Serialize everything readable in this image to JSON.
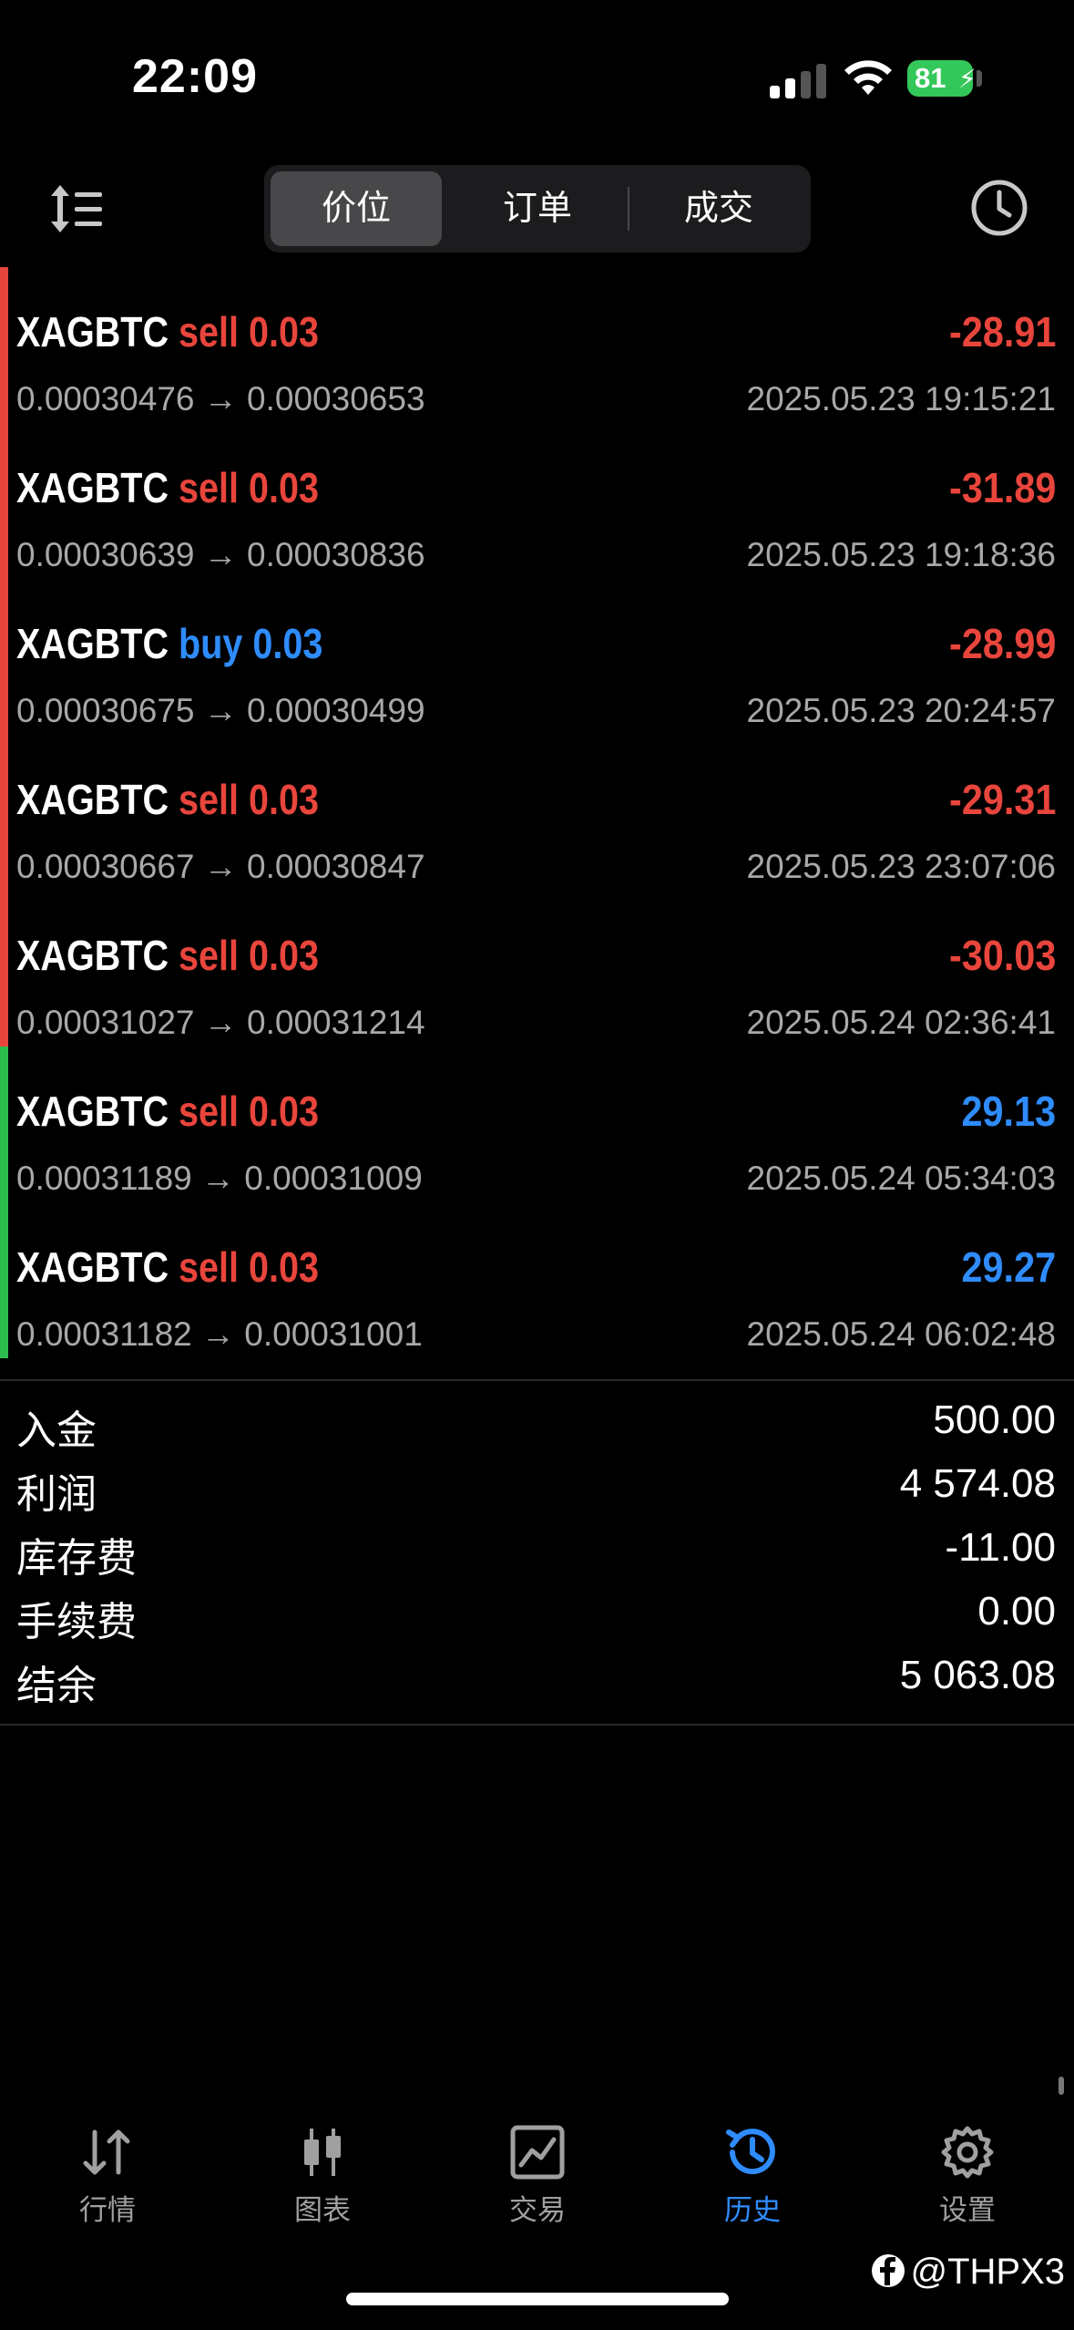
{
  "status_bar": {
    "time": "22:09",
    "battery": "81"
  },
  "toolbar": {
    "tabs": [
      {
        "label": "价位"
      },
      {
        "label": "订单"
      },
      {
        "label": "成交"
      }
    ]
  },
  "deals": [
    {
      "symbol": "XAGBTC",
      "type": "sell",
      "volume": "0.03",
      "prices": "0.00030476 → 0.00030653",
      "profit": "-28.91",
      "time": "2025.05.23 19:15:21"
    },
    {
      "symbol": "XAGBTC",
      "type": "sell",
      "volume": "0.03",
      "prices": "0.00030639 → 0.00030836",
      "profit": "-31.89",
      "time": "2025.05.23 19:18:36"
    },
    {
      "symbol": "XAGBTC",
      "type": "buy",
      "volume": "0.03",
      "prices": "0.00030675 → 0.00030499",
      "profit": "-28.99",
      "time": "2025.05.23 20:24:57"
    },
    {
      "symbol": "XAGBTC",
      "type": "sell",
      "volume": "0.03",
      "prices": "0.00030667 → 0.00030847",
      "profit": "-29.31",
      "time": "2025.05.23 23:07:06"
    },
    {
      "symbol": "XAGBTC",
      "type": "sell",
      "volume": "0.03",
      "prices": "0.00031027 → 0.00031214",
      "profit": "-30.03",
      "time": "2025.05.24 02:36:41"
    },
    {
      "symbol": "XAGBTC",
      "type": "sell",
      "volume": "0.03",
      "prices": "0.00031189 → 0.00031009",
      "profit": "29.13",
      "time": "2025.05.24 05:34:03"
    },
    {
      "symbol": "XAGBTC",
      "type": "sell",
      "volume": "0.03",
      "prices": "0.00031182 → 0.00031001",
      "profit": "29.27",
      "time": "2025.05.24 06:02:48"
    }
  ],
  "summary": [
    {
      "label": "入金",
      "value": "500.00"
    },
    {
      "label": "利润",
      "value": "4 574.08"
    },
    {
      "label": "库存费",
      "value": "-11.00"
    },
    {
      "label": "手续费",
      "value": "0.00"
    },
    {
      "label": "结余",
      "value": "5 063.08"
    }
  ],
  "tabbar": [
    {
      "label": "行情",
      "icon": "arrows-updown-icon"
    },
    {
      "label": "图表",
      "icon": "candlestick-icon"
    },
    {
      "label": "交易",
      "icon": "trade-chart-icon"
    },
    {
      "label": "历史",
      "icon": "history-icon"
    },
    {
      "label": "设置",
      "icon": "gear-icon"
    }
  ],
  "watermark": "@THPX3",
  "colors": {
    "sell": "#e8453c",
    "buy": "#2f8cff",
    "loss": "#e8453c",
    "gain": "#2f8cff",
    "bar_loss": "#e8453c",
    "bar_gain": "#2dbd4e",
    "active_tab": "#2f8cff"
  }
}
